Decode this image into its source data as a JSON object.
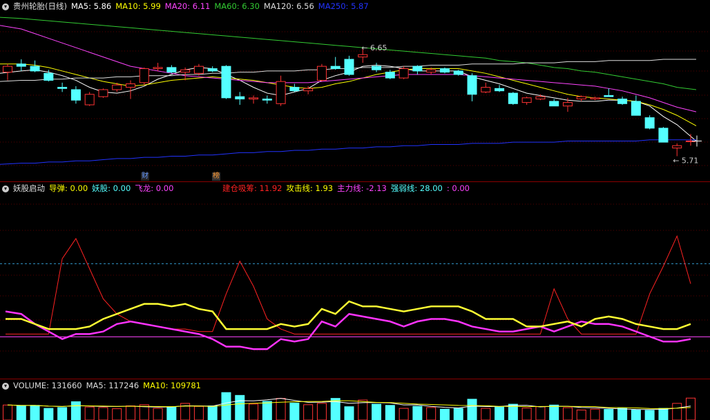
{
  "main": {
    "title": "贵州轮胎(日线)",
    "ma": [
      {
        "label": "MA5: 5.86",
        "color": "#ffffff"
      },
      {
        "label": "MA10: 5.99",
        "color": "#ffff00"
      },
      {
        "label": "MA20: 6.11",
        "color": "#ff44ff"
      },
      {
        "label": "MA60: 6.30",
        "color": "#33cc33"
      },
      {
        "label": "MA120: 6.56",
        "color": "#dddddd"
      },
      {
        "label": "MA250: 5.87",
        "color": "#2233ff"
      }
    ],
    "high_label": "6.65",
    "low_label": "5.71",
    "markers": [
      {
        "text": "财",
        "color": "#6699ff"
      },
      {
        "text": "榜",
        "color": "#ff9933"
      }
    ],
    "up_color": "#ff3333",
    "down_color": "#54ffff",
    "price_range": [
      5.65,
      6.95
    ]
  },
  "chart_data": {
    "type": "candlestick",
    "note_x": "trading days, left to right",
    "ohlc": [
      [
        6.45,
        6.52,
        6.38,
        6.5
      ],
      [
        6.52,
        6.56,
        6.46,
        6.5
      ],
      [
        6.5,
        6.55,
        6.45,
        6.46
      ],
      [
        6.44,
        6.47,
        6.37,
        6.38
      ],
      [
        6.32,
        6.36,
        6.28,
        6.31
      ],
      [
        6.3,
        6.33,
        6.18,
        6.21
      ],
      [
        6.17,
        6.28,
        6.16,
        6.26
      ],
      [
        6.24,
        6.31,
        6.23,
        6.3
      ],
      [
        6.3,
        6.36,
        6.28,
        6.34
      ],
      [
        6.32,
        6.38,
        6.22,
        6.35
      ],
      [
        6.36,
        6.49,
        6.34,
        6.48
      ],
      [
        6.48,
        6.53,
        6.46,
        6.49
      ],
      [
        6.49,
        6.51,
        6.44,
        6.45
      ],
      [
        6.45,
        6.49,
        6.38,
        6.47
      ],
      [
        6.44,
        6.52,
        6.42,
        6.5
      ],
      [
        6.48,
        6.5,
        6.45,
        6.46
      ],
      [
        6.5,
        6.51,
        6.22,
        6.23
      ],
      [
        6.24,
        6.28,
        6.17,
        6.22
      ],
      [
        6.22,
        6.25,
        6.18,
        6.23
      ],
      [
        6.22,
        6.25,
        6.18,
        6.21
      ],
      [
        6.18,
        6.42,
        6.16,
        6.37
      ],
      [
        6.32,
        6.35,
        6.28,
        6.29
      ],
      [
        6.29,
        6.33,
        6.26,
        6.31
      ],
      [
        6.38,
        6.52,
        6.37,
        6.5
      ],
      [
        6.5,
        6.58,
        6.47,
        6.48
      ],
      [
        6.56,
        6.59,
        6.42,
        6.43
      ],
      [
        6.58,
        6.65,
        6.53,
        6.6
      ],
      [
        6.5,
        6.53,
        6.45,
        6.47
      ],
      [
        6.45,
        6.47,
        6.39,
        6.4
      ],
      [
        6.4,
        6.5,
        6.39,
        6.48
      ],
      [
        6.5,
        6.51,
        6.43,
        6.46
      ],
      [
        6.45,
        6.49,
        6.43,
        6.47
      ],
      [
        6.48,
        6.49,
        6.44,
        6.45
      ],
      [
        6.46,
        6.47,
        6.42,
        6.43
      ],
      [
        6.42,
        6.44,
        6.2,
        6.26
      ],
      [
        6.28,
        6.36,
        6.27,
        6.32
      ],
      [
        6.31,
        6.34,
        6.28,
        6.29
      ],
      [
        6.27,
        6.28,
        6.17,
        6.18
      ],
      [
        6.19,
        6.24,
        6.17,
        6.23
      ],
      [
        6.22,
        6.26,
        6.21,
        6.24
      ],
      [
        6.2,
        6.22,
        6.16,
        6.16
      ],
      [
        6.16,
        6.23,
        6.11,
        6.19
      ],
      [
        6.22,
        6.25,
        6.2,
        6.24
      ],
      [
        6.22,
        6.24,
        6.21,
        6.23
      ],
      [
        6.25,
        6.31,
        6.24,
        6.24
      ],
      [
        6.22,
        6.24,
        6.17,
        6.18
      ],
      [
        6.2,
        6.25,
        6.08,
        6.08
      ],
      [
        6.06,
        6.08,
        5.96,
        5.97
      ],
      [
        5.97,
        5.98,
        5.86,
        5.85
      ],
      [
        5.8,
        5.84,
        5.73,
        5.82
      ],
      [
        5.86,
        5.92,
        5.82,
        5.86
      ]
    ],
    "moving_averages": {
      "MA5": [
        6.44,
        6.46,
        6.47,
        6.45,
        6.42,
        6.38,
        6.32,
        6.28,
        6.27,
        6.29,
        6.33,
        6.39,
        6.43,
        6.47,
        6.49,
        6.48,
        6.43,
        6.38,
        6.32,
        6.27,
        6.25,
        6.28,
        6.31,
        6.38,
        6.42,
        6.45,
        6.5,
        6.51,
        6.5,
        6.48,
        6.46,
        6.46,
        6.46,
        6.46,
        6.41,
        6.38,
        6.35,
        6.31,
        6.27,
        6.25,
        6.23,
        6.21,
        6.2,
        6.2,
        6.21,
        6.21,
        6.2,
        6.16,
        6.07,
        6.0,
        5.86
      ],
      "MA10": [
        6.52,
        6.52,
        6.51,
        6.49,
        6.46,
        6.43,
        6.4,
        6.37,
        6.35,
        6.33,
        6.34,
        6.36,
        6.38,
        6.39,
        6.4,
        6.41,
        6.4,
        6.39,
        6.38,
        6.36,
        6.34,
        6.32,
        6.31,
        6.32,
        6.35,
        6.37,
        6.4,
        6.43,
        6.45,
        6.47,
        6.48,
        6.48,
        6.48,
        6.48,
        6.46,
        6.44,
        6.41,
        6.38,
        6.35,
        6.32,
        6.29,
        6.26,
        6.24,
        6.23,
        6.22,
        6.21,
        6.2,
        6.17,
        6.13,
        6.08,
        5.99
      ],
      "MA20": [
        6.85,
        6.82,
        6.78,
        6.74,
        6.7,
        6.66,
        6.62,
        6.58,
        6.54,
        6.5,
        6.48,
        6.46,
        6.44,
        6.42,
        6.41,
        6.4,
        6.39,
        6.38,
        6.37,
        6.36,
        6.36,
        6.36,
        6.36,
        6.37,
        6.38,
        6.39,
        6.4,
        6.41,
        6.42,
        6.43,
        6.43,
        6.43,
        6.43,
        6.43,
        6.42,
        6.41,
        6.4,
        6.39,
        6.38,
        6.37,
        6.36,
        6.35,
        6.34,
        6.33,
        6.31,
        6.29,
        6.26,
        6.23,
        6.19,
        6.15,
        6.11
      ],
      "MA60": [
        6.92,
        6.91,
        6.9,
        6.89,
        6.88,
        6.87,
        6.86,
        6.85,
        6.84,
        6.83,
        6.82,
        6.81,
        6.8,
        6.79,
        6.78,
        6.77,
        6.76,
        6.75,
        6.74,
        6.73,
        6.72,
        6.71,
        6.7,
        6.69,
        6.68,
        6.67,
        6.66,
        6.65,
        6.64,
        6.63,
        6.62,
        6.61,
        6.6,
        6.59,
        6.58,
        6.57,
        6.55,
        6.54,
        6.53,
        6.51,
        6.49,
        6.48,
        6.46,
        6.45,
        6.43,
        6.41,
        6.39,
        6.37,
        6.35,
        6.32,
        6.3
      ],
      "MA120": [
        6.37,
        6.38,
        6.38,
        6.39,
        6.39,
        6.4,
        6.4,
        6.4,
        6.41,
        6.41,
        6.42,
        6.42,
        6.42,
        6.43,
        6.43,
        6.44,
        6.44,
        6.45,
        6.45,
        6.46,
        6.46,
        6.46,
        6.47,
        6.47,
        6.48,
        6.48,
        6.49,
        6.49,
        6.49,
        6.5,
        6.5,
        6.51,
        6.51,
        6.51,
        6.52,
        6.52,
        6.52,
        6.52,
        6.53,
        6.53,
        6.53,
        6.54,
        6.54,
        6.54,
        6.55,
        6.55,
        6.55,
        6.55,
        6.56,
        6.56,
        6.56
      ],
      "MA250": [
        5.66,
        5.67,
        5.67,
        5.68,
        5.68,
        5.69,
        5.69,
        5.7,
        5.71,
        5.71,
        5.72,
        5.72,
        5.73,
        5.73,
        5.74,
        5.74,
        5.75,
        5.76,
        5.76,
        5.77,
        5.77,
        5.78,
        5.78,
        5.79,
        5.79,
        5.8,
        5.8,
        5.81,
        5.81,
        5.82,
        5.82,
        5.83,
        5.83,
        5.83,
        5.84,
        5.84,
        5.84,
        5.85,
        5.85,
        5.85,
        5.85,
        5.86,
        5.86,
        5.86,
        5.86,
        5.86,
        5.86,
        5.87,
        5.87,
        5.87,
        5.87
      ]
    }
  },
  "indicator": {
    "name": "妖股启动",
    "items": [
      {
        "label": "导弹: 0.00",
        "color": "#ffff00"
      },
      {
        "label": "妖股: 0.00",
        "color": "#54ffff"
      },
      {
        "label": "飞龙: 0.00",
        "color": "#ff44ff"
      }
    ],
    "items2": [
      {
        "label": "建仓吸筹: 11.92",
        "color": "#ff2222"
      },
      {
        "label": "攻击线: 1.93",
        "color": "#ffff00"
      },
      {
        "label": "主力线: -2.13",
        "color": "#ff44ff"
      },
      {
        "label": "强弱线: 28.00",
        "color": "#54ffff"
      },
      {
        "label": ": 0.00",
        "color": "#ff44ff"
      }
    ],
    "range": [
      -15,
      55
    ],
    "strength_level": 28.0,
    "series": {
      "建仓吸筹": [
        0,
        0,
        0,
        0,
        30,
        38,
        26,
        14,
        8,
        5,
        4,
        3,
        2,
        2,
        1,
        1,
        16,
        29,
        19,
        6,
        2,
        0,
        0,
        0,
        0,
        0,
        0,
        0,
        0,
        0,
        0,
        0,
        0,
        0,
        0,
        0,
        0,
        0,
        0,
        0,
        18,
        6,
        0,
        0,
        0,
        0,
        0,
        16,
        27,
        39,
        20
      ],
      "攻击线": [
        6,
        6,
        4,
        2,
        2,
        2,
        3,
        6,
        8,
        10,
        12,
        12,
        11,
        12,
        10,
        9,
        2,
        2,
        2,
        2,
        4,
        3,
        4,
        10,
        8,
        13,
        11,
        11,
        10,
        9,
        10,
        11,
        11,
        11,
        9,
        6,
        6,
        6,
        3,
        3,
        4,
        5,
        3,
        6,
        7,
        6,
        4,
        3,
        2,
        2,
        4
      ],
      "主力线": [
        9,
        8,
        4,
        1,
        -2,
        0,
        0,
        1,
        4,
        5,
        4,
        3,
        2,
        1,
        0,
        -2,
        -5,
        -5,
        -6,
        -6,
        -2,
        -3,
        -2,
        5,
        3,
        8,
        7,
        6,
        5,
        3,
        5,
        6,
        6,
        5,
        3,
        2,
        1,
        1,
        2,
        3,
        1,
        3,
        5,
        4,
        4,
        3,
        1,
        -1,
        -3,
        -3,
        -2
      ],
      "zero_line": 0
    }
  },
  "volume": {
    "label": "VOLUME: 131660",
    "ma5": "MA5: 117246",
    "ma10": "MA10: 109781",
    "values": [
      90,
      85,
      88,
      70,
      75,
      110,
      78,
      75,
      68,
      85,
      92,
      70,
      80,
      100,
      82,
      85,
      165,
      148,
      96,
      112,
      130,
      102,
      92,
      100,
      130,
      80,
      120,
      95,
      88,
      70,
      82,
      75,
      65,
      70,
      125,
      70,
      78,
      95,
      72,
      80,
      90,
      74,
      60,
      65,
      64,
      70,
      60,
      58,
      70,
      100,
      131.66
    ]
  }
}
